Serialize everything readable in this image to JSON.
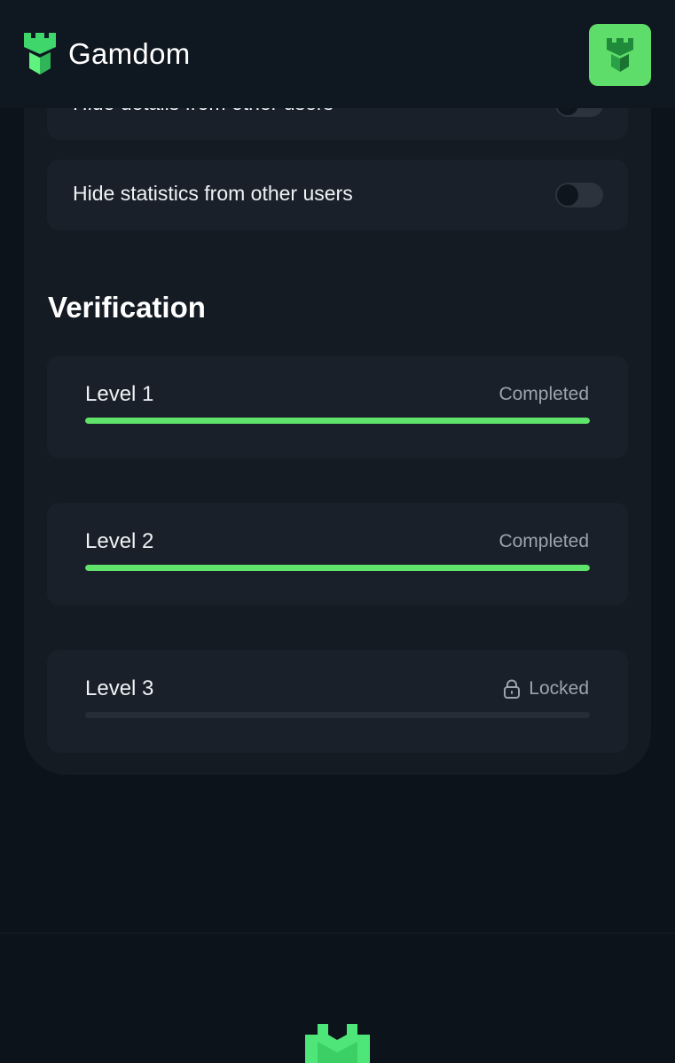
{
  "header": {
    "brand_name": "Gamdom",
    "menu_button_icon": "castle-icon",
    "accent_color": "#5fdd6a"
  },
  "privacy": {
    "items": [
      {
        "label": "Hide details from other users",
        "enabled": false
      },
      {
        "label": "Hide statistics from other users",
        "enabled": false
      }
    ]
  },
  "verification": {
    "title": "Verification",
    "levels": [
      {
        "name": "Level 1",
        "status": "Completed",
        "progress": 1.0,
        "locked": false
      },
      {
        "name": "Level 2",
        "status": "Completed",
        "progress": 1.0,
        "locked": false
      },
      {
        "name": "Level 3",
        "status": "Locked",
        "progress": 0.0,
        "locked": true,
        "status_icon": "lock-icon"
      }
    ]
  },
  "footer": {
    "logo_icon": "gamdom-logo-icon"
  }
}
